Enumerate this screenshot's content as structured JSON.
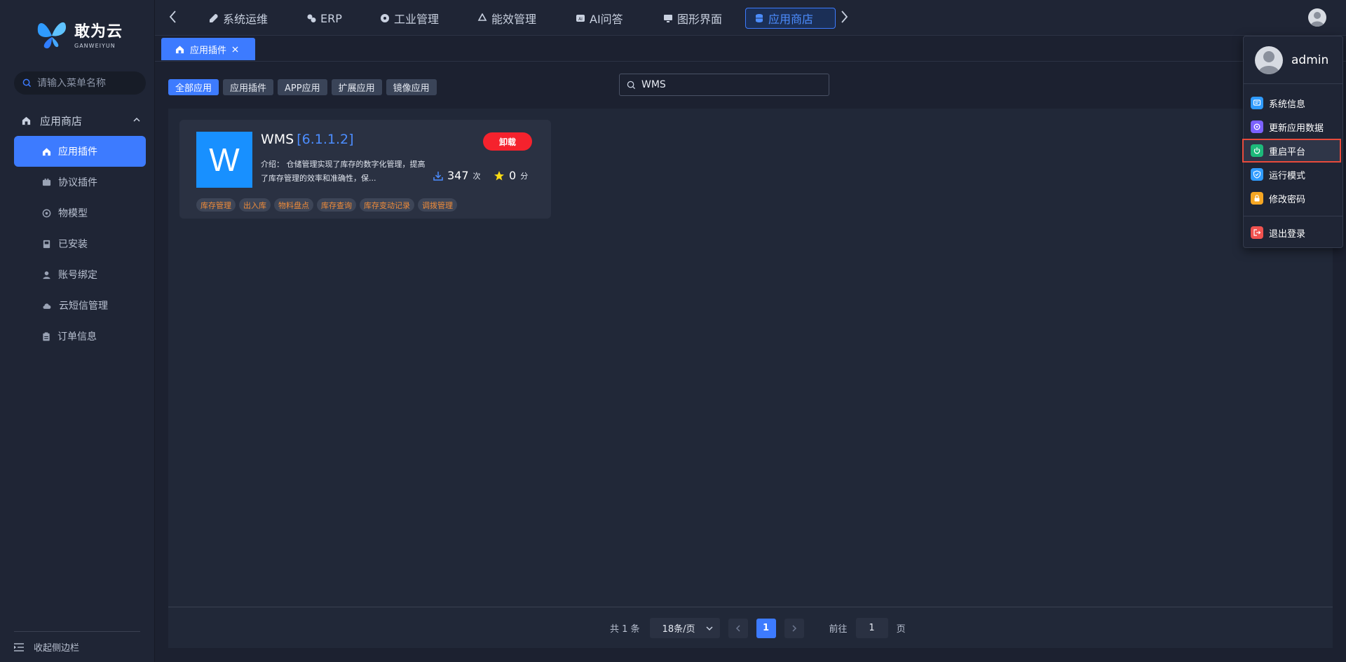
{
  "brand": {
    "name": "敢为云",
    "sub": "GANWEIYUN"
  },
  "sidebar": {
    "search_placeholder": "请输入菜单名称",
    "group": "应用商店",
    "items": [
      {
        "label": "应用插件",
        "icon": "home-icon"
      },
      {
        "label": "协议插件",
        "icon": "plugin-icon"
      },
      {
        "label": "物模型",
        "icon": "model-icon"
      },
      {
        "label": "已安装",
        "icon": "installed-icon"
      },
      {
        "label": "账号绑定",
        "icon": "user-icon"
      },
      {
        "label": "云短信管理",
        "icon": "cloud-icon"
      },
      {
        "label": "订单信息",
        "icon": "clipboard-icon"
      }
    ],
    "collapse_label": "收起侧边栏"
  },
  "topnav": {
    "tabs": [
      "系统运维",
      "ERP",
      "工业管理",
      "能效管理",
      "AI问答",
      "图形界面",
      "应用商店"
    ],
    "active": "应用商店"
  },
  "page_tab": {
    "label": "应用插件"
  },
  "filters": [
    "全部应用",
    "应用插件",
    "APP应用",
    "扩展应用",
    "镜像应用"
  ],
  "search": {
    "value": "WMS"
  },
  "app": {
    "logo_letter": "W",
    "name": "WMS",
    "version": "[6.1.1.2]",
    "action": "卸载",
    "desc_label": "介绍：",
    "desc": "仓储管理实现了库存的数字化管理，提高了库存管理的效率和准确性，保...",
    "downloads": "347",
    "downloads_unit": "次",
    "score": "0",
    "score_unit": "分",
    "tags": [
      "库存管理",
      "出入库",
      "物料盘点",
      "库存查询",
      "库存变动记录",
      "调拨管理"
    ]
  },
  "pager": {
    "total": "共 1 条",
    "page_size": "18条/页",
    "current": "1",
    "goto_label": "前往",
    "goto_value": "1",
    "page_suffix": "页"
  },
  "user_menu": {
    "username": "admin",
    "items": [
      "系统信息",
      "更新应用数据",
      "重启平台",
      "运行模式",
      "修改密码"
    ],
    "logout": "退出登录",
    "highlighted": "重启平台"
  },
  "colors": {
    "accent": "#3d7bff",
    "danger": "#f5222d",
    "tag": "#f08c3a",
    "app_logo": "#1890ff"
  }
}
